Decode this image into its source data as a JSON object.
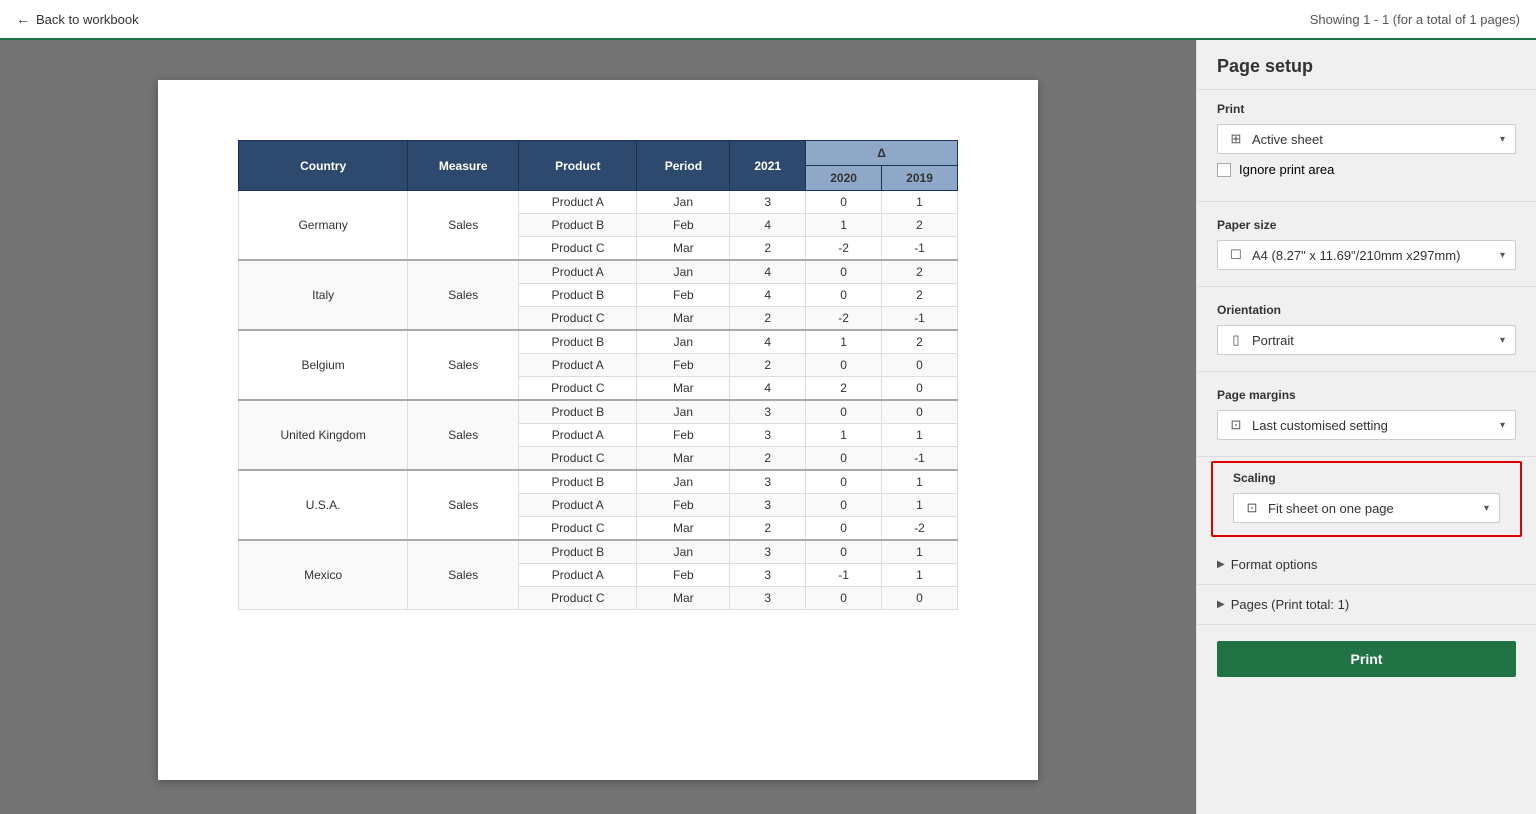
{
  "topbar": {
    "back_label": "Back to workbook",
    "showing_label": "Showing 1 - 1 (for a total of 1 pages)"
  },
  "panel": {
    "title": "Page setup",
    "print_section": {
      "label": "Print",
      "active_sheet_option": "Active sheet",
      "ignore_print_area_label": "Ignore print area"
    },
    "paper_size_section": {
      "label": "Paper size",
      "value": "A4 (8.27\" x 11.69\"/210mm x297mm)"
    },
    "orientation_section": {
      "label": "Orientation",
      "value": "Portrait"
    },
    "page_margins_section": {
      "label": "Page margins",
      "value": "Last customised setting"
    },
    "scaling_section": {
      "label": "Scaling",
      "value": "Fit sheet on one page"
    },
    "format_options_label": "Format options",
    "pages_label": "Pages (Print total: 1)",
    "print_button_label": "Print"
  },
  "table": {
    "headers": [
      "Country",
      "Measure",
      "Product",
      "Period",
      "2021",
      "2020",
      "2019"
    ],
    "delta_header": "Δ",
    "groups": [
      {
        "country": "Germany",
        "measure": "Sales",
        "rows": [
          {
            "product": "Product A",
            "period": "Jan",
            "v2021": "3",
            "v2020": "0",
            "v2019": "1",
            "color2020": "normal",
            "color2019": "blue"
          },
          {
            "product": "Product B",
            "period": "Feb",
            "v2021": "4",
            "v2020": "1",
            "v2019": "2",
            "color2020": "blue",
            "color2019": "blue"
          },
          {
            "product": "Product C",
            "period": "Mar",
            "v2021": "2",
            "v2020": "-2",
            "v2019": "-1",
            "color2020": "red",
            "color2019": "red"
          }
        ]
      },
      {
        "country": "Italy",
        "measure": "Sales",
        "rows": [
          {
            "product": "Product A",
            "period": "Jan",
            "v2021": "4",
            "v2020": "0",
            "v2019": "2",
            "color2020": "normal",
            "color2019": "blue"
          },
          {
            "product": "Product B",
            "period": "Feb",
            "v2021": "4",
            "v2020": "0",
            "v2019": "2",
            "color2020": "normal",
            "color2019": "blue"
          },
          {
            "product": "Product C",
            "period": "Mar",
            "v2021": "2",
            "v2020": "-2",
            "v2019": "-1",
            "color2020": "red",
            "color2019": "red"
          }
        ]
      },
      {
        "country": "Belgium",
        "measure": "Sales",
        "rows": [
          {
            "product": "Product B",
            "period": "Jan",
            "v2021": "4",
            "v2020": "1",
            "v2019": "2",
            "color2020": "blue",
            "color2019": "blue"
          },
          {
            "product": "Product A",
            "period": "Feb",
            "v2021": "2",
            "v2020": "0",
            "v2019": "0",
            "color2020": "normal",
            "color2019": "normal"
          },
          {
            "product": "Product C",
            "period": "Mar",
            "v2021": "4",
            "v2020": "2",
            "v2019": "0",
            "color2020": "blue",
            "color2019": "normal"
          }
        ]
      },
      {
        "country": "United Kingdom",
        "measure": "Sales",
        "rows": [
          {
            "product": "Product B",
            "period": "Jan",
            "v2021": "3",
            "v2020": "0",
            "v2019": "0",
            "color2020": "normal",
            "color2019": "normal"
          },
          {
            "product": "Product A",
            "period": "Feb",
            "v2021": "3",
            "v2020": "1",
            "v2019": "1",
            "color2020": "blue",
            "color2019": "blue"
          },
          {
            "product": "Product C",
            "period": "Mar",
            "v2021": "2",
            "v2020": "0",
            "v2019": "-1",
            "color2020": "normal",
            "color2019": "red"
          }
        ]
      },
      {
        "country": "U.S.A.",
        "measure": "Sales",
        "rows": [
          {
            "product": "Product B",
            "period": "Jan",
            "v2021": "3",
            "v2020": "0",
            "v2019": "1",
            "color2020": "normal",
            "color2019": "blue"
          },
          {
            "product": "Product A",
            "period": "Feb",
            "v2021": "3",
            "v2020": "0",
            "v2019": "1",
            "color2020": "normal",
            "color2019": "blue"
          },
          {
            "product": "Product C",
            "period": "Mar",
            "v2021": "2",
            "v2020": "0",
            "v2019": "-2",
            "color2020": "normal",
            "color2019": "red"
          }
        ]
      },
      {
        "country": "Mexico",
        "measure": "Sales",
        "rows": [
          {
            "product": "Product B",
            "period": "Jan",
            "v2021": "3",
            "v2020": "0",
            "v2019": "1",
            "color2020": "normal",
            "color2019": "blue"
          },
          {
            "product": "Product A",
            "period": "Feb",
            "v2021": "3",
            "v2020": "-1",
            "v2019": "1",
            "color2020": "red",
            "color2019": "blue"
          },
          {
            "product": "Product C",
            "period": "Mar",
            "v2021": "3",
            "v2020": "0",
            "v2019": "0",
            "color2020": "normal",
            "color2019": "normal"
          }
        ]
      }
    ]
  }
}
